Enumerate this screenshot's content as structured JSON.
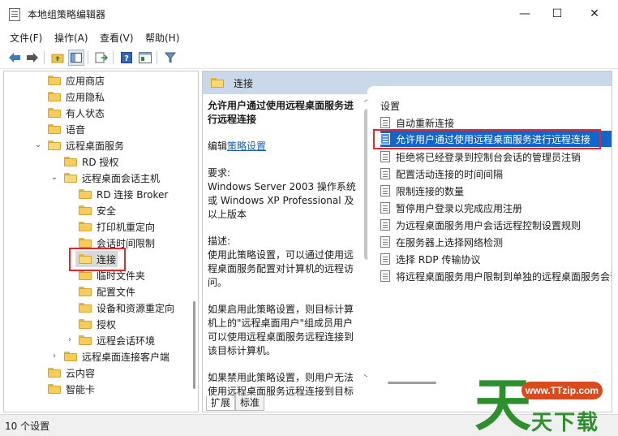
{
  "window": {
    "title": "本地组策略编辑器",
    "minimize_glyph": "—",
    "maximize_glyph": "☐",
    "close_glyph": "✕"
  },
  "menu": [
    "文件(F)",
    "操作(A)",
    "查看(V)",
    "帮助(H)"
  ],
  "toolbar": {
    "back_icon": "arrow-left-icon",
    "forward_icon": "arrow-right-icon",
    "up_folder_icon": "up-folder-icon",
    "show_hide_tree_icon": "tree-panel-icon",
    "export_icon": "export-list-icon",
    "help_icon": "help-icon",
    "properties_icon": "properties-icon",
    "filter_icon": "filter-icon"
  },
  "tree": {
    "items": [
      {
        "label": "应用商店"
      },
      {
        "label": "应用隐私"
      },
      {
        "label": "有人状态"
      },
      {
        "label": "语音"
      },
      {
        "label": "远程桌面服务",
        "expanded": true
      },
      {
        "label": "RD 授权"
      },
      {
        "label": "远程桌面会话主机",
        "expanded": true
      },
      {
        "label": "RD 连接 Broker"
      },
      {
        "label": "安全"
      },
      {
        "label": "打印机重定向"
      },
      {
        "label": "会话时间限制"
      },
      {
        "label": "连接",
        "selected": true
      },
      {
        "label": "临时文件夹"
      },
      {
        "label": "配置文件"
      },
      {
        "label": "设备和资源重定向"
      },
      {
        "label": "授权"
      },
      {
        "label": "远程会话环境",
        "expanded": false
      },
      {
        "label": "远程桌面连接客户端",
        "expanded": false
      },
      {
        "label": "云内容"
      },
      {
        "label": "智能卡"
      }
    ]
  },
  "detail": {
    "header": "连接",
    "policy_title": "允许用户通过使用远程桌面服务进行远程连接",
    "edit_prefix": "编辑",
    "edit_link": "策略设置",
    "requirements_label": "要求:",
    "requirements_text": "Windows Server 2003 操作系统或 Windows XP Professional 及以上版本",
    "description_label": "描述:",
    "description_text": "使用此策略设置，可以通过使用远程桌面服务配置对计算机的远程访问。",
    "enabled_text": "如果启用此策略设置，则目标计算机上的\"远程桌面用户\"组成员用户可以使用远程桌面服务远程连接到该目标计算机。",
    "disabled_text": "如果禁用此策略设置，则用户无法使用远程桌面服务远程连接到目标",
    "tabs": [
      "扩展",
      "标准"
    ],
    "settings_header": "设置",
    "settings": [
      {
        "label": "自动重新连接"
      },
      {
        "label": "允许用户通过使用远程桌面服务进行远程连接",
        "selected": true
      },
      {
        "label": "拒绝将已经登录到控制台会话的管理员注销"
      },
      {
        "label": "配置活动连接的时间间隔"
      },
      {
        "label": "限制连接的数量"
      },
      {
        "label": "暂停用户登录以完成应用注册"
      },
      {
        "label": "为远程桌面服务用户会话远程控制设置规则"
      },
      {
        "label": "在服务器上选择网络检测"
      },
      {
        "label": "选择 RDP 传输协议"
      },
      {
        "label": "将远程桌面服务用户限制到单独的远程桌面服务会话"
      }
    ]
  },
  "status": {
    "text": "10 个设置"
  },
  "watermark": {
    "url": "www.TTzip.com",
    "big_char": "天",
    "sub_text": "天下载"
  }
}
